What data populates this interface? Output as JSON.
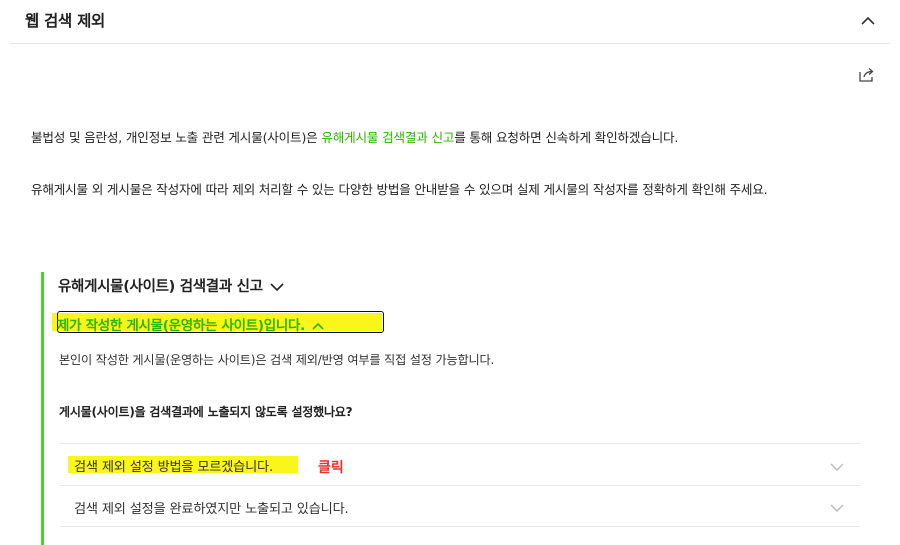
{
  "header": {
    "title": "웹 검색 제외"
  },
  "intro": {
    "p1_before": "불법성 및 음란성, 개인정보 노출 관련 게시물(사이트)은 ",
    "p1_link": "유해게시물 검색결과 신고",
    "p1_after": "를 통해 요청하면 신속하게 확인하겠습니다.",
    "p2": "유해게시물 외 게시물은 작성자에 따라 제외 처리할 수 있는 다양한 방법을 안내받을 수 있으며 실제 게시물의 작성자를 정확하게 확인해 주세요."
  },
  "section": {
    "title": "유해게시물(사이트) 검색결과 신고",
    "sub_title": "제가 작성한 게시물(운영하는 사이트)입니다.",
    "desc": "본인이 작성한 게시물(운영하는 사이트)은 검색 제외/반영 여부를 직접 설정 가능합니다.",
    "question": "게시물(사이트)을 검색결과에 노출되지 않도록 설정했나요?",
    "options": [
      {
        "label": "검색 제외 설정 방법을 모르겠습니다."
      },
      {
        "label": "검색 제외 설정을 완료하였지만 노출되고 있습니다."
      }
    ]
  },
  "annotation": {
    "click_label": "클릭"
  },
  "colors": {
    "accent_green": "#2db400",
    "bar_green": "#4ccf2c",
    "highlight": "#faf51a",
    "annotation_red": "#e8342a"
  },
  "icons": [
    "chevron-up-icon",
    "share-icon",
    "chevron-down-icon"
  ]
}
